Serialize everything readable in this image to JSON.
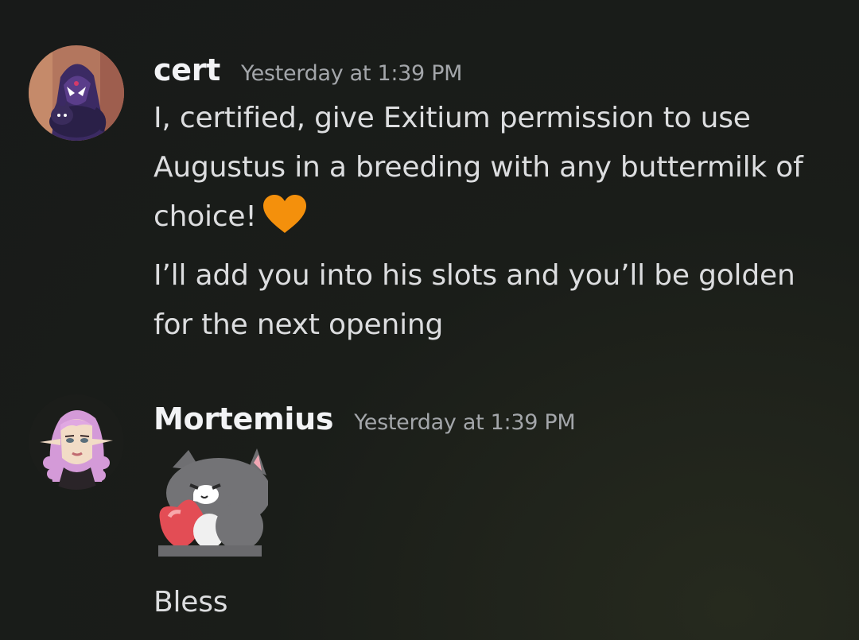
{
  "messages": [
    {
      "author": "cert",
      "timestamp": "Yesterday at 1:39 PM",
      "avatar": "raven-avatar",
      "paragraphs": [
        "I, certified, give Exitium permission to use Augustus in a breeding with any buttermilk of choice!",
        "I’ll add you into his slots and you’ll be golden for the next opening"
      ],
      "emoji": "orange-heart"
    },
    {
      "author": "Mortemius",
      "timestamp": "Yesterday at 1:39 PM",
      "avatar": "elf-avatar",
      "sticker": "cat-hugging-heart-sticker",
      "text": "Bless"
    }
  ],
  "colors": {
    "background": "#1a1d19",
    "username": "#f2f3f5",
    "timestamp": "#a3a6aa",
    "message_text": "#dcdddf",
    "heart": "#f4900c"
  }
}
